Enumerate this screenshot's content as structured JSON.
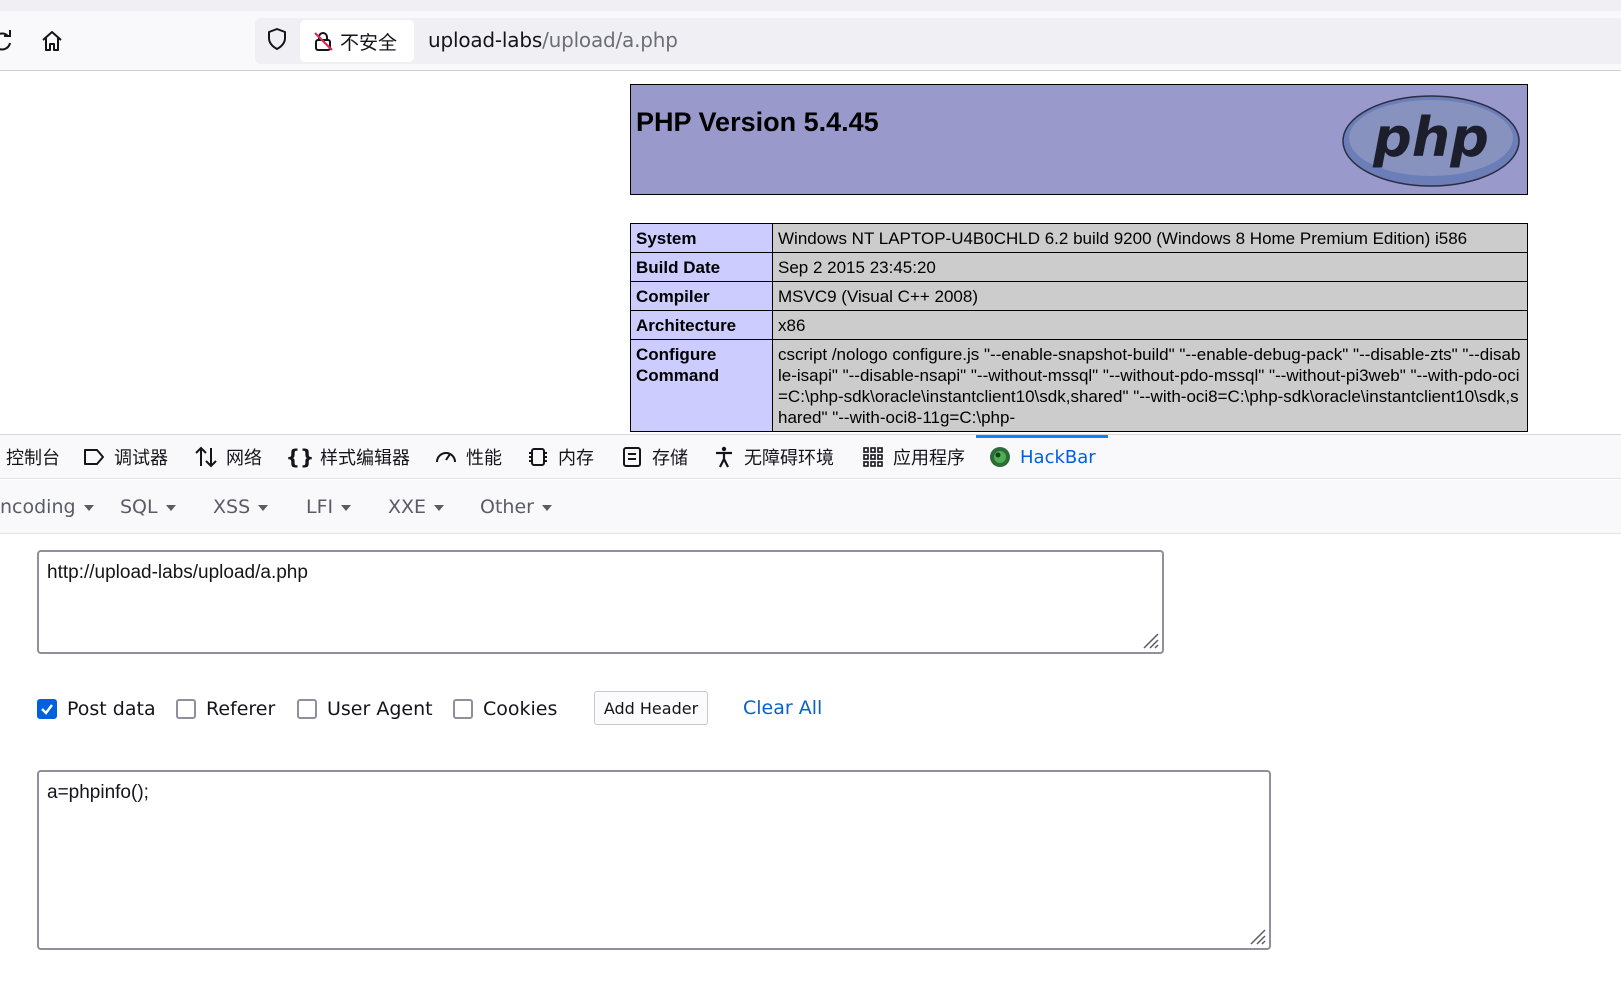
{
  "browser": {
    "insecure_label": "不安全",
    "url_host": "upload-labs",
    "url_path": "/upload/a.php"
  },
  "phpinfo": {
    "title": "PHP Version 5.4.45",
    "logo_text": "php",
    "rows": [
      {
        "label": "System",
        "value": "Windows NT LAPTOP-U4B0CHLD 6.2 build 9200 (Windows 8 Home Premium Edition) i586"
      },
      {
        "label": "Build Date",
        "value": "Sep 2 2015 23:45:20"
      },
      {
        "label": "Compiler",
        "value": "MSVC9 (Visual C++ 2008)"
      },
      {
        "label": "Architecture",
        "value": "x86"
      },
      {
        "label": "Configure Command",
        "value": "cscript /nologo configure.js \"--enable-snapshot-build\" \"--enable-debug-pack\" \"--disable-zts\" \"--disable-isapi\" \"--disable-nsapi\" \"--without-mssql\" \"--without-pdo-mssql\" \"--without-pi3web\" \"--with-pdo-oci=C:\\php-sdk\\oracle\\instantclient10\\sdk,shared\" \"--with-oci8=C:\\php-sdk\\oracle\\instantclient10\\sdk,shared\" \"--with-oci8-11g=C:\\php-"
      }
    ]
  },
  "devtools": {
    "tabs": [
      {
        "label": "控制台",
        "icon": "console-icon"
      },
      {
        "label": "调试器",
        "icon": "debugger-icon"
      },
      {
        "label": "网络",
        "icon": "network-icon"
      },
      {
        "label": "样式编辑器",
        "icon": "style-editor-icon"
      },
      {
        "label": "性能",
        "icon": "performance-icon"
      },
      {
        "label": "内存",
        "icon": "memory-icon"
      },
      {
        "label": "存储",
        "icon": "storage-icon"
      },
      {
        "label": "无障碍环境",
        "icon": "accessibility-icon"
      },
      {
        "label": "应用程序",
        "icon": "application-icon"
      },
      {
        "label": "HackBar",
        "icon": "hackbar-icon"
      }
    ],
    "active_tab": "HackBar",
    "accent_color": "#0a84ff"
  },
  "hackbar": {
    "menu": [
      {
        "label": "ncoding"
      },
      {
        "label": "SQL"
      },
      {
        "label": "XSS"
      },
      {
        "label": "LFI"
      },
      {
        "label": "XXE"
      },
      {
        "label": "Other"
      }
    ],
    "url_value": "http://upload-labs/upload/a.php",
    "options": {
      "post_data": {
        "label": "Post data",
        "checked": true
      },
      "referer": {
        "label": "Referer",
        "checked": false
      },
      "user_agent": {
        "label": "User Agent",
        "checked": false
      },
      "cookies": {
        "label": "Cookies",
        "checked": false
      }
    },
    "add_header_label": "Add Header",
    "clear_all_label": "Clear All",
    "post_body": "a=phpinfo();"
  }
}
